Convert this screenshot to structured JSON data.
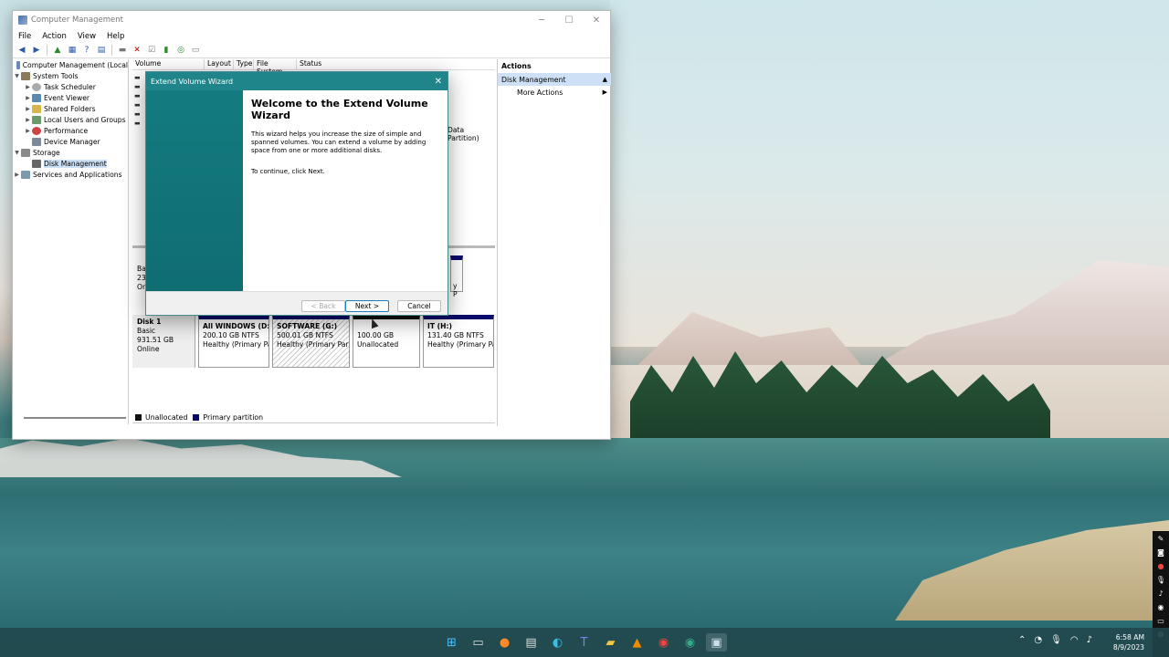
{
  "window": {
    "title": "Computer Management",
    "controls": {
      "minimize": "─",
      "maximize": "☐",
      "close": "✕"
    }
  },
  "menu": [
    "File",
    "Action",
    "View",
    "Help"
  ],
  "tree": {
    "root": "Computer Management (Local",
    "system_tools": "System Tools",
    "items": [
      "Task Scheduler",
      "Event Viewer",
      "Shared Folders",
      "Local Users and Groups",
      "Performance",
      "Device Manager"
    ],
    "storage": "Storage",
    "disk_management": "Disk Management",
    "services": "Services and Applications"
  },
  "columns": [
    "Volume",
    "Layout",
    "Type",
    "File System",
    "Status"
  ],
  "partial_text": {
    "data_partition": "Data Partition)"
  },
  "disk0": {
    "lines": [
      "Basi",
      "238",
      "Onl"
    ],
    "right_partial": "y P"
  },
  "disk1": {
    "name": "Disk 1",
    "type": "Basic",
    "size": "931.51 GB",
    "status": "Online",
    "partitions": [
      {
        "name": "All WINDOWS (D:)",
        "size": "200.10 GB NTFS",
        "status": "Healthy (Primary Pa",
        "kind": "primary"
      },
      {
        "name": "SOFTWARE (G:)",
        "size": "500.01 GB NTFS",
        "status": "Healthy (Primary Parti",
        "kind": "primary"
      },
      {
        "name": "",
        "size": "100.00 GB",
        "status": "Unallocated",
        "kind": "unallocated"
      },
      {
        "name": "IT (H:)",
        "size": "131.40 GB NTFS",
        "status": "Healthy (Primary Pa",
        "kind": "primary"
      }
    ]
  },
  "legend": {
    "unallocated": "Unallocated",
    "primary": "Primary partition",
    "unalloc_color": "#111111",
    "primary_color": "#0a0a6a"
  },
  "actions": {
    "header": "Actions",
    "section": "Disk Management",
    "more": "More Actions"
  },
  "wizard": {
    "title": "Extend Volume Wizard",
    "heading": "Welcome to the Extend Volume Wizard",
    "description": "This wizard helps you increase the size of simple and spanned volumes. You can extend a volume  by adding space from one or more additional disks.",
    "continue": "To continue, click Next.",
    "back": "< Back",
    "next": "Next >",
    "cancel": "Cancel"
  },
  "taskbar": {
    "icons": [
      "windows-start",
      "file-explorer-alt",
      "firefox",
      "clapper",
      "edge",
      "teams",
      "folder",
      "vlc",
      "chrome",
      "chrome-profile",
      "computer-management"
    ],
    "time": "6:58 AM",
    "date": "8/9/2023"
  }
}
